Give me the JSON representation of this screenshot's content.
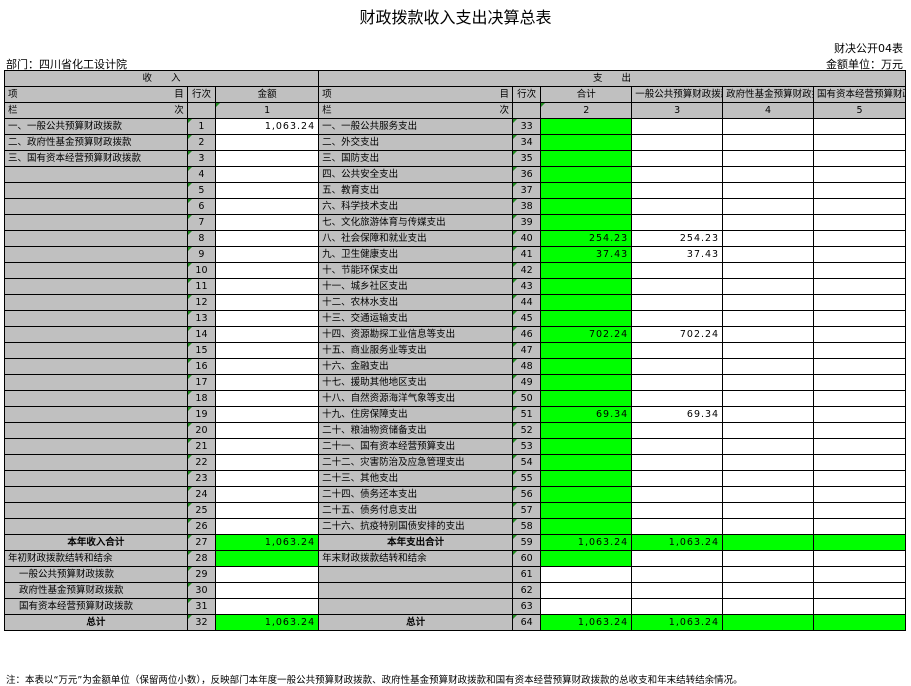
{
  "title": "财政拨款收入支出决算总表",
  "form_no": "财决公开04表",
  "department": "部门：四川省化工设计院",
  "unit": "金额单位：万元",
  "headers": {
    "income": "收　　入",
    "expense": "支　　出",
    "item_left": "项",
    "item_right": "目",
    "line_no": "行次",
    "amount": "金额",
    "total": "合计",
    "general_budget": "一般公共预算财政拨款",
    "gov_fund": "政府性基金预算财政拨款",
    "state_capital": "国有资本经营预算财政拨款",
    "col_left": "栏",
    "col_right": "次",
    "col1": "1",
    "col2": "2",
    "col3": "3",
    "col4": "4",
    "col5": "5"
  },
  "rows": [
    {
      "inc": "一、一般公共预算财政拨款",
      "il": "1",
      "ia": "1,063.24",
      "exp": "一、一般公共服务支出",
      "el": "33",
      "t": "",
      "g": ""
    },
    {
      "inc": "二、政府性基金预算财政拨款",
      "il": "2",
      "ia": "",
      "exp": "二、外交支出",
      "el": "34",
      "t": "",
      "g": ""
    },
    {
      "inc": "三、国有资本经营预算财政拨款",
      "il": "3",
      "ia": "",
      "exp": "三、国防支出",
      "el": "35",
      "t": "",
      "g": ""
    },
    {
      "inc": "",
      "il": "4",
      "ia": "",
      "exp": "四、公共安全支出",
      "el": "36",
      "t": "",
      "g": ""
    },
    {
      "inc": "",
      "il": "5",
      "ia": "",
      "exp": "五、教育支出",
      "el": "37",
      "t": "",
      "g": ""
    },
    {
      "inc": "",
      "il": "6",
      "ia": "",
      "exp": "六、科学技术支出",
      "el": "38",
      "t": "",
      "g": ""
    },
    {
      "inc": "",
      "il": "7",
      "ia": "",
      "exp": "七、文化旅游体育与传媒支出",
      "el": "39",
      "t": "",
      "g": ""
    },
    {
      "inc": "",
      "il": "8",
      "ia": "",
      "exp": "八、社会保障和就业支出",
      "el": "40",
      "t": "254.23",
      "g": "254.23"
    },
    {
      "inc": "",
      "il": "9",
      "ia": "",
      "exp": "九、卫生健康支出",
      "el": "41",
      "t": "37.43",
      "g": "37.43"
    },
    {
      "inc": "",
      "il": "10",
      "ia": "",
      "exp": "十、节能环保支出",
      "el": "42",
      "t": "",
      "g": ""
    },
    {
      "inc": "",
      "il": "11",
      "ia": "",
      "exp": "十一、城乡社区支出",
      "el": "43",
      "t": "",
      "g": ""
    },
    {
      "inc": "",
      "il": "12",
      "ia": "",
      "exp": "十二、农林水支出",
      "el": "44",
      "t": "",
      "g": ""
    },
    {
      "inc": "",
      "il": "13",
      "ia": "",
      "exp": "十三、交通运输支出",
      "el": "45",
      "t": "",
      "g": ""
    },
    {
      "inc": "",
      "il": "14",
      "ia": "",
      "exp": "十四、资源勘探工业信息等支出",
      "el": "46",
      "t": "702.24",
      "g": "702.24"
    },
    {
      "inc": "",
      "il": "15",
      "ia": "",
      "exp": "十五、商业服务业等支出",
      "el": "47",
      "t": "",
      "g": ""
    },
    {
      "inc": "",
      "il": "16",
      "ia": "",
      "exp": "十六、金融支出",
      "el": "48",
      "t": "",
      "g": ""
    },
    {
      "inc": "",
      "il": "17",
      "ia": "",
      "exp": "十七、援助其他地区支出",
      "el": "49",
      "t": "",
      "g": ""
    },
    {
      "inc": "",
      "il": "18",
      "ia": "",
      "exp": "十八、自然资源海洋气象等支出",
      "el": "50",
      "t": "",
      "g": ""
    },
    {
      "inc": "",
      "il": "19",
      "ia": "",
      "exp": "十九、住房保障支出",
      "el": "51",
      "t": "69.34",
      "g": "69.34"
    },
    {
      "inc": "",
      "il": "20",
      "ia": "",
      "exp": "二十、粮油物资储备支出",
      "el": "52",
      "t": "",
      "g": ""
    },
    {
      "inc": "",
      "il": "21",
      "ia": "",
      "exp": "二十一、国有资本经营预算支出",
      "el": "53",
      "t": "",
      "g": ""
    },
    {
      "inc": "",
      "il": "22",
      "ia": "",
      "exp": "二十二、灾害防治及应急管理支出",
      "el": "54",
      "t": "",
      "g": ""
    },
    {
      "inc": "",
      "il": "23",
      "ia": "",
      "exp": "二十三、其他支出",
      "el": "55",
      "t": "",
      "g": ""
    },
    {
      "inc": "",
      "il": "24",
      "ia": "",
      "exp": "二十四、债务还本支出",
      "el": "56",
      "t": "",
      "g": ""
    },
    {
      "inc": "",
      "il": "25",
      "ia": "",
      "exp": "二十五、债务付息支出",
      "el": "57",
      "t": "",
      "g": ""
    },
    {
      "inc": "",
      "il": "26",
      "ia": "",
      "exp": "二十六、抗疫特别国债安排的支出",
      "el": "58",
      "t": "",
      "g": ""
    }
  ],
  "year_income_total": {
    "label": "本年收入合计",
    "line": "27",
    "amount": "1,063.24"
  },
  "year_expense_total": {
    "label": "本年支出合计",
    "line": "59",
    "total": "1,063.24",
    "general": "1,063.24"
  },
  "carry_over": {
    "label": "年初财政拨款结转和结余",
    "line": "28",
    "exp_label": "年末财政拨款结转和结余",
    "exp_line": "60"
  },
  "sub_rows": [
    {
      "label": "一般公共预算财政拨款",
      "line": "29",
      "eline": "61"
    },
    {
      "label": "政府性基金预算财政拨款",
      "line": "30",
      "eline": "62"
    },
    {
      "label": "国有资本经营预算财政拨款",
      "line": "31",
      "eline": "63"
    }
  ],
  "grand_total": {
    "label": "总计",
    "line": "32",
    "amount": "1,063.24",
    "exp_label": "总计",
    "exp_line": "64",
    "total": "1,063.24",
    "general": "1,063.24"
  },
  "note": "注：本表以“万元”为金额单位（保留两位小数），反映部门本年度一般公共预算财政拨款、政府性基金预算财政拨款和国有资本经营预算财政拨款的总收支和年末结转结余情况。"
}
